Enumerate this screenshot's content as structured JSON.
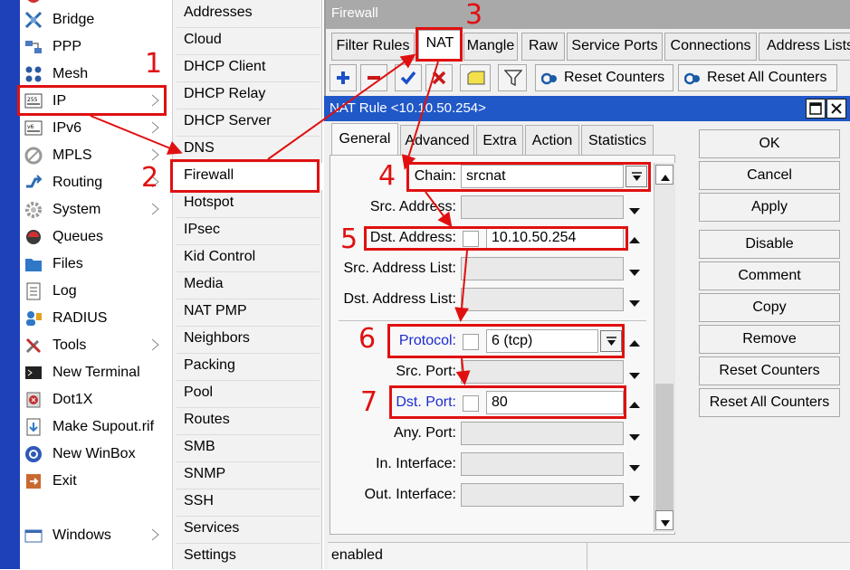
{
  "main_menu": {
    "items": [
      {
        "label": "Bridge",
        "icon": "bridge-icon"
      },
      {
        "label": "PPP",
        "icon": "ppp-icon"
      },
      {
        "label": "Mesh",
        "icon": "mesh-icon"
      },
      {
        "label": "IP",
        "icon": "ip-icon"
      },
      {
        "label": "IPv6",
        "icon": "ipv6-icon"
      },
      {
        "label": "MPLS",
        "icon": "mpls-icon"
      },
      {
        "label": "Routing",
        "icon": "routing-icon"
      },
      {
        "label": "System",
        "icon": "gear-icon"
      },
      {
        "label": "Queues",
        "icon": "queues-icon"
      },
      {
        "label": "Files",
        "icon": "folder-icon"
      },
      {
        "label": "Log",
        "icon": "log-icon"
      },
      {
        "label": "RADIUS",
        "icon": "radius-icon"
      },
      {
        "label": "Tools",
        "icon": "tools-icon"
      },
      {
        "label": "New Terminal",
        "icon": "terminal-icon"
      },
      {
        "label": "Dot1X",
        "icon": "dot1x-icon"
      },
      {
        "label": "Make Supout.rif",
        "icon": "supout-icon"
      },
      {
        "label": "New WinBox",
        "icon": "winbox-icon"
      },
      {
        "label": "Exit",
        "icon": "exit-icon"
      },
      {
        "label": "Windows",
        "icon": "windows-icon"
      }
    ]
  },
  "ip_submenu": {
    "items": [
      "Addresses",
      "Cloud",
      "DHCP Client",
      "DHCP Relay",
      "DHCP Server",
      "DNS",
      "Firewall",
      "Hotspot",
      "IPsec",
      "Kid Control",
      "Media",
      "NAT PMP",
      "Neighbors",
      "Packing",
      "Pool",
      "Routes",
      "SMB",
      "SNMP",
      "SSH",
      "Services",
      "Settings"
    ]
  },
  "firewall": {
    "title": "Firewall",
    "tabs": [
      "Filter Rules",
      "NAT",
      "Mangle",
      "Raw",
      "Service Ports",
      "Connections",
      "Address Lists"
    ],
    "toolbar": {
      "reset_counters": "Reset Counters",
      "reset_all_counters": "Reset All Counters"
    }
  },
  "nat_dialog": {
    "title": "NAT Rule <10.10.50.254>",
    "tabs": [
      "General",
      "Advanced",
      "Extra",
      "Action",
      "Statistics"
    ],
    "fields": {
      "chain": {
        "label": "Chain:",
        "value": "srcnat"
      },
      "src_address": {
        "label": "Src. Address:"
      },
      "dst_address": {
        "label": "Dst. Address:",
        "value": "10.10.50.254"
      },
      "src_address_list": {
        "label": "Src. Address List:"
      },
      "dst_address_list": {
        "label": "Dst. Address List:"
      },
      "protocol": {
        "label": "Protocol:",
        "value": "6 (tcp)"
      },
      "src_port": {
        "label": "Src. Port:"
      },
      "dst_port": {
        "label": "Dst. Port:",
        "value": "80"
      },
      "any_port": {
        "label": "Any. Port:"
      },
      "in_interface": {
        "label": "In. Interface:"
      },
      "out_interface": {
        "label": "Out. Interface:"
      }
    },
    "buttons": [
      "OK",
      "Cancel",
      "Apply",
      "Disable",
      "Comment",
      "Copy",
      "Remove",
      "Reset Counters",
      "Reset All Counters"
    ],
    "status": "enabled"
  },
  "annotations": {
    "steps": [
      "1",
      "2",
      "3",
      "4",
      "5",
      "6",
      "7"
    ],
    "color": "#e01010"
  }
}
